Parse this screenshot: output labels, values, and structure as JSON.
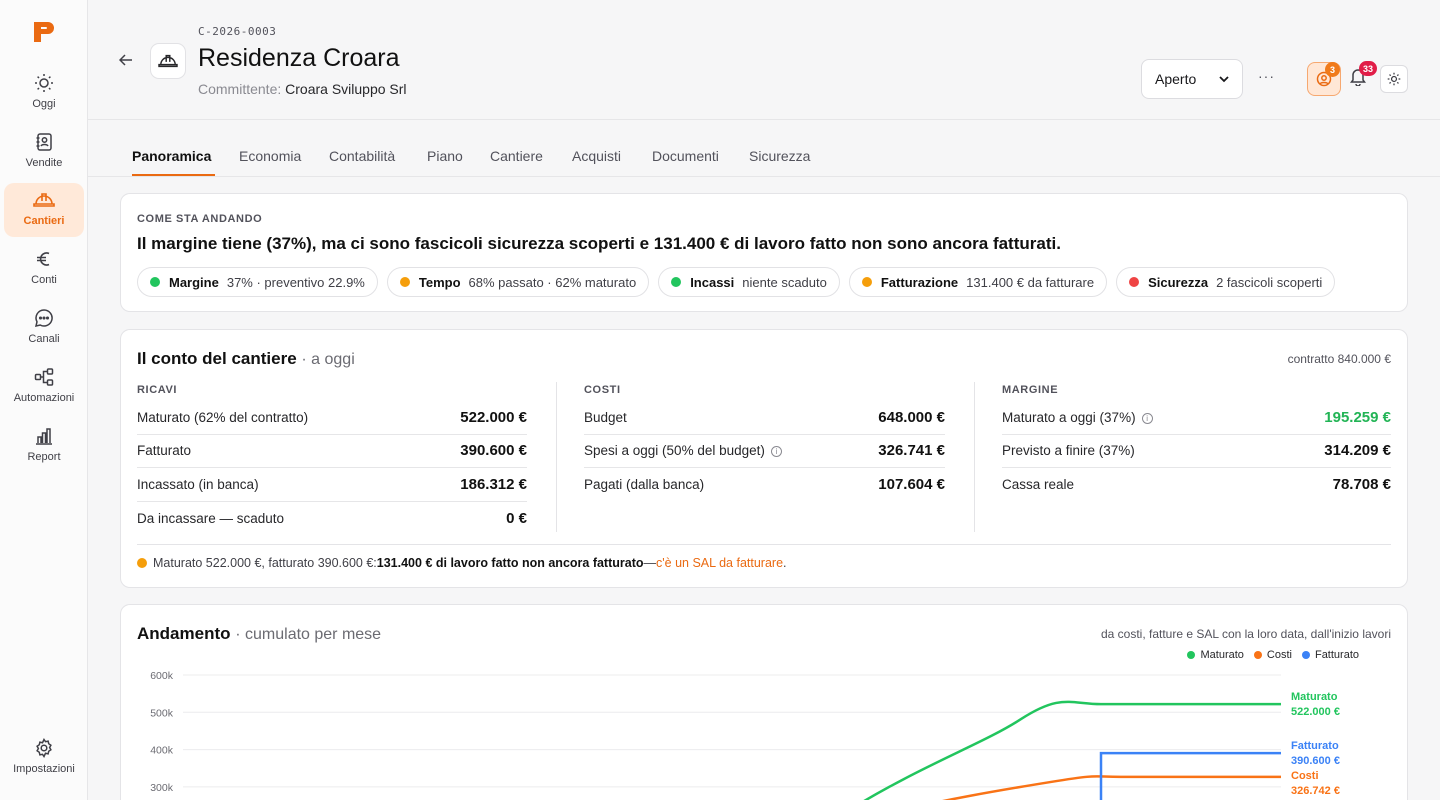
{
  "sidebar": {
    "items": [
      {
        "label": "Oggi",
        "icon": "sun-icon"
      },
      {
        "label": "Vendite",
        "icon": "contacts-icon"
      },
      {
        "label": "Cantieri",
        "icon": "hard-hat-icon",
        "active": true
      },
      {
        "label": "Conti",
        "icon": "euro-icon"
      },
      {
        "label": "Canali",
        "icon": "chat-icon"
      },
      {
        "label": "Automazioni",
        "icon": "workflow-icon"
      },
      {
        "label": "Report",
        "icon": "bar-chart-icon"
      }
    ],
    "settings_label": "Impostazioni"
  },
  "header": {
    "code": "C-2026-0003",
    "title": "Residenza Croara",
    "client_label": "Committente:",
    "client_name": "Croara Sviluppo Srl",
    "status": "Aperto",
    "more": "···",
    "team_badge": "3",
    "notifications_badge": "33"
  },
  "tabs": [
    "Panoramica",
    "Economia",
    "Contabilità",
    "Piano",
    "Cantiere",
    "Acquisti",
    "Documenti",
    "Sicurezza"
  ],
  "summary": {
    "eyebrow": "COME STA ANDANDO",
    "headline": "Il margine tiene (37%), ma ci sono fascicoli sicurezza scoperti e 131.400 € di lavoro fatto non sono ancora fatturati.",
    "chips": [
      {
        "name": "Margine",
        "value": "37% · preventivo 22.9%",
        "color": "#22c55e"
      },
      {
        "name": "Tempo",
        "value": "68% passato · 62% maturato",
        "color": "#f59e0b"
      },
      {
        "name": "Incassi",
        "value": "niente scaduto",
        "color": "#22c55e"
      },
      {
        "name": "Fatturazione",
        "value": "131.400 € da fatturare",
        "color": "#f59e0b"
      },
      {
        "name": "Sicurezza",
        "value": "2 fascicoli scoperti",
        "color": "#ef4444"
      }
    ]
  },
  "conto": {
    "title": "Il conto del cantiere",
    "subtitle": "· a oggi",
    "contract": "contratto 840.000 €",
    "ricavi": {
      "label": "RICAVI",
      "rows": [
        {
          "label": "Maturato (62% del contratto)",
          "value": "522.000 €"
        },
        {
          "label": "Fatturato",
          "value": "390.600 €"
        },
        {
          "label": "Incassato (in banca)",
          "value": "186.312 €"
        },
        {
          "label": "Da incassare — scaduto",
          "value": "0 €"
        }
      ]
    },
    "costi": {
      "label": "COSTI",
      "rows": [
        {
          "label": "Budget",
          "value": "648.000 €"
        },
        {
          "label": "Spesi a oggi (50% del budget)",
          "value": "326.741 €",
          "info": true
        },
        {
          "label": "Pagati (dalla banca)",
          "value": "107.604 €"
        }
      ]
    },
    "margine": {
      "label": "MARGINE",
      "rows": [
        {
          "label": "Maturato a oggi (37%)",
          "value": "195.259 €",
          "info": true,
          "highlight": true
        },
        {
          "label": "Previsto a finire (37%)",
          "value": "314.209 €"
        },
        {
          "label": "Cassa reale",
          "value": "78.708 €"
        }
      ]
    },
    "note": {
      "prefix": "Maturato 522.000 €, fatturato 390.600 €: ",
      "bold": "131.400 € di lavoro fatto non ancora fatturato",
      "dash": " — ",
      "link": "c'è un SAL da fatturare",
      "suffix": "."
    }
  },
  "andamento": {
    "title": "Andamento",
    "subtitle": "· cumulato per mese",
    "source": "da costi, fatture e SAL con la loro data, dall'inizio lavori"
  },
  "chart_data": {
    "type": "line",
    "title": "Andamento",
    "y_ticks": [
      "600k",
      "500k",
      "400k",
      "300k"
    ],
    "ylim": [
      0,
      600000
    ],
    "legend_position": "top-right",
    "series": [
      {
        "name": "Maturato",
        "color": "#22c55e",
        "end_label": "522.000 €",
        "end_value": 522000
      },
      {
        "name": "Costi",
        "color": "#f97316",
        "end_label": "326.742 €",
        "end_value": 326742
      },
      {
        "name": "Fatturato",
        "color": "#3b82f6",
        "end_label": "390.600 €",
        "end_value": 390600
      }
    ]
  }
}
